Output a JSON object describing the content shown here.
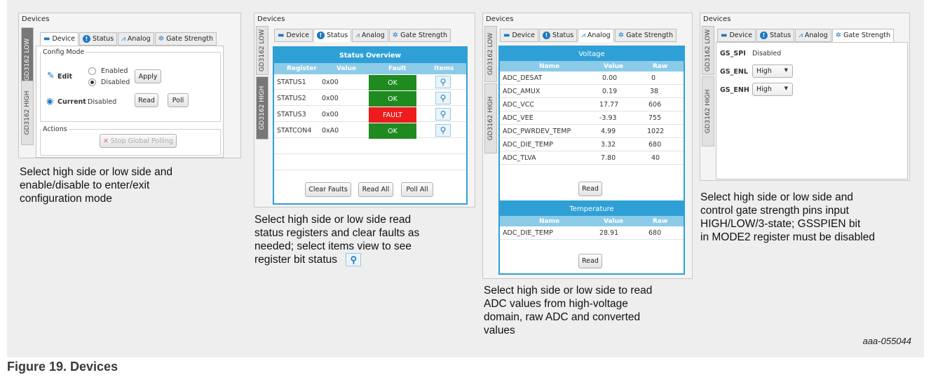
{
  "figure": {
    "label": "Figure 19.  Devices",
    "code": "aaa-055044"
  },
  "tabs": {
    "device": "Device",
    "status": "Status",
    "analog": "Analog",
    "gate": "Gate Strength"
  },
  "common": {
    "window_title": "Devices",
    "vtab_low": "GD3162 LOW",
    "vtab_high": "GD3162 HIGH"
  },
  "panel1": {
    "config_mode": "Config Mode",
    "edit": "Edit",
    "enabled": "Enabled",
    "disabled": "Disabled",
    "apply": "Apply",
    "current": "Current",
    "current_value": "Disabled",
    "read": "Read",
    "poll": "Poll",
    "actions": "Actions",
    "stop_polling": "Stop Global Polling",
    "caption": [
      "Select high side or low side and",
      "enable/disable to enter/exit",
      "configuration mode"
    ]
  },
  "panel2": {
    "title": "Status Overview",
    "columns": [
      "Register",
      "Value",
      "Fault",
      "Items"
    ],
    "rows": [
      {
        "register": "STATUS1",
        "value": "0x00",
        "fault": "OK"
      },
      {
        "register": "STATUS2",
        "value": "0x00",
        "fault": "OK"
      },
      {
        "register": "STATUS3",
        "value": "0x00",
        "fault": "FAULT"
      },
      {
        "register": "STATCON4",
        "value": "0xA0",
        "fault": "OK"
      }
    ],
    "clear_faults": "Clear Faults",
    "read_all": "Read All",
    "poll_all": "Poll All",
    "ok_color": "#1f8a1f",
    "fault_color": "#ee1c1c",
    "caption": [
      "Select high side or low side read",
      "status registers and clear faults as",
      "needed; select items view to see",
      "register bit status"
    ]
  },
  "panel3": {
    "voltage_title": "Voltage",
    "columns": [
      "Name",
      "Value",
      "Raw"
    ],
    "voltage_rows": [
      {
        "name": "ADC_DESAT",
        "value": "0.00",
        "raw": "0"
      },
      {
        "name": "ADC_AMUX",
        "value": "0.19",
        "raw": "38"
      },
      {
        "name": "ADC_VCC",
        "value": "17.77",
        "raw": "606"
      },
      {
        "name": "ADC_VEE",
        "value": "-3.93",
        "raw": "755"
      },
      {
        "name": "ADC_PWRDEV_TEMP",
        "value": "4.99",
        "raw": "1022"
      },
      {
        "name": "ADC_DIE_TEMP",
        "value": "3.32",
        "raw": "680"
      },
      {
        "name": "ADC_TLVA",
        "value": "7.80",
        "raw": "40"
      }
    ],
    "read": "Read",
    "temp_title": "Temperature",
    "temp_rows": [
      {
        "name": "ADC_DIE_TEMP",
        "value": "28.91",
        "raw": "680"
      }
    ],
    "read2": "Read",
    "caption": [
      "Select high side or low side to read",
      "ADC values from high-voltage",
      "domain, raw ADC and converted",
      "values"
    ]
  },
  "panel4": {
    "gs_spi_label": "GS_SPI",
    "gs_spi_value": "Disabled",
    "gs_enl_label": "GS_ENL",
    "gs_enl_value": "High",
    "gs_enh_label": "GS_ENH",
    "gs_enh_value": "High",
    "caption": [
      "Select high side or low side and",
      "control gate strength pins input",
      "HIGH/LOW/3-state; GSSPIEN bit",
      "in MODE2 register must be disabled"
    ]
  }
}
